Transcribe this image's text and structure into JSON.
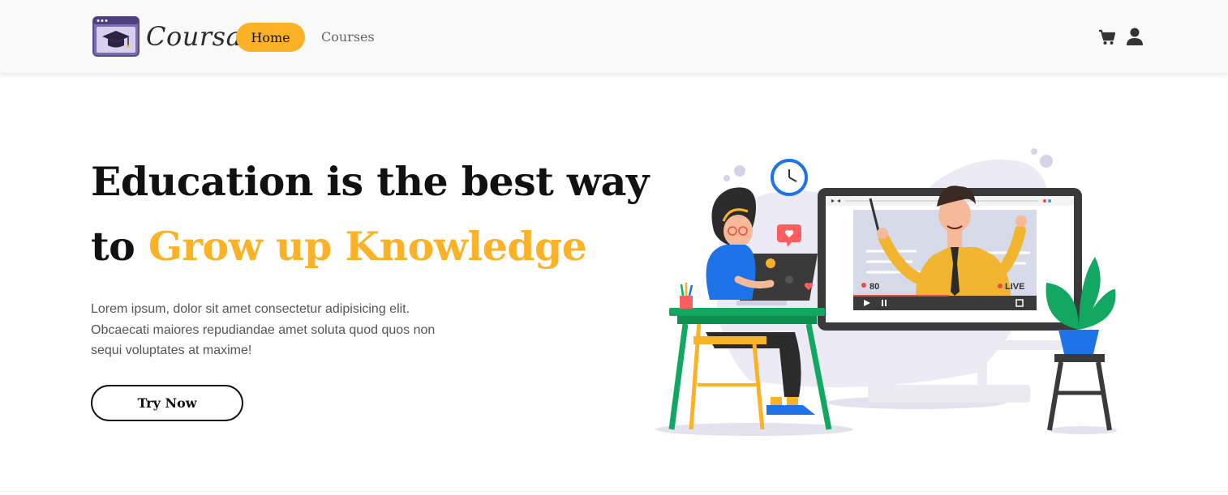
{
  "brand": {
    "name": "Coursatk",
    "logo_icon": "graduation-cap-window-icon"
  },
  "nav": {
    "home_label": "Home",
    "courses_label": "Courses",
    "accent_color": "#fbb226"
  },
  "header_icons": {
    "cart": "shopping-cart-icon",
    "user": "user-icon"
  },
  "hero": {
    "title_line1": "Education is the best way",
    "title_line2_prefix": "to",
    "title_line2_accent": "Grow up Knowledge",
    "description": "Lorem ipsum, dolor sit amet consectetur adipisicing elit. Obcaecati maiores repudiandae amet soluta quod quos non sequi voluptates at maxime!",
    "cta_label": "Try Now"
  },
  "illustration": {
    "viewer_count": "80",
    "live_label": "LIVE"
  }
}
